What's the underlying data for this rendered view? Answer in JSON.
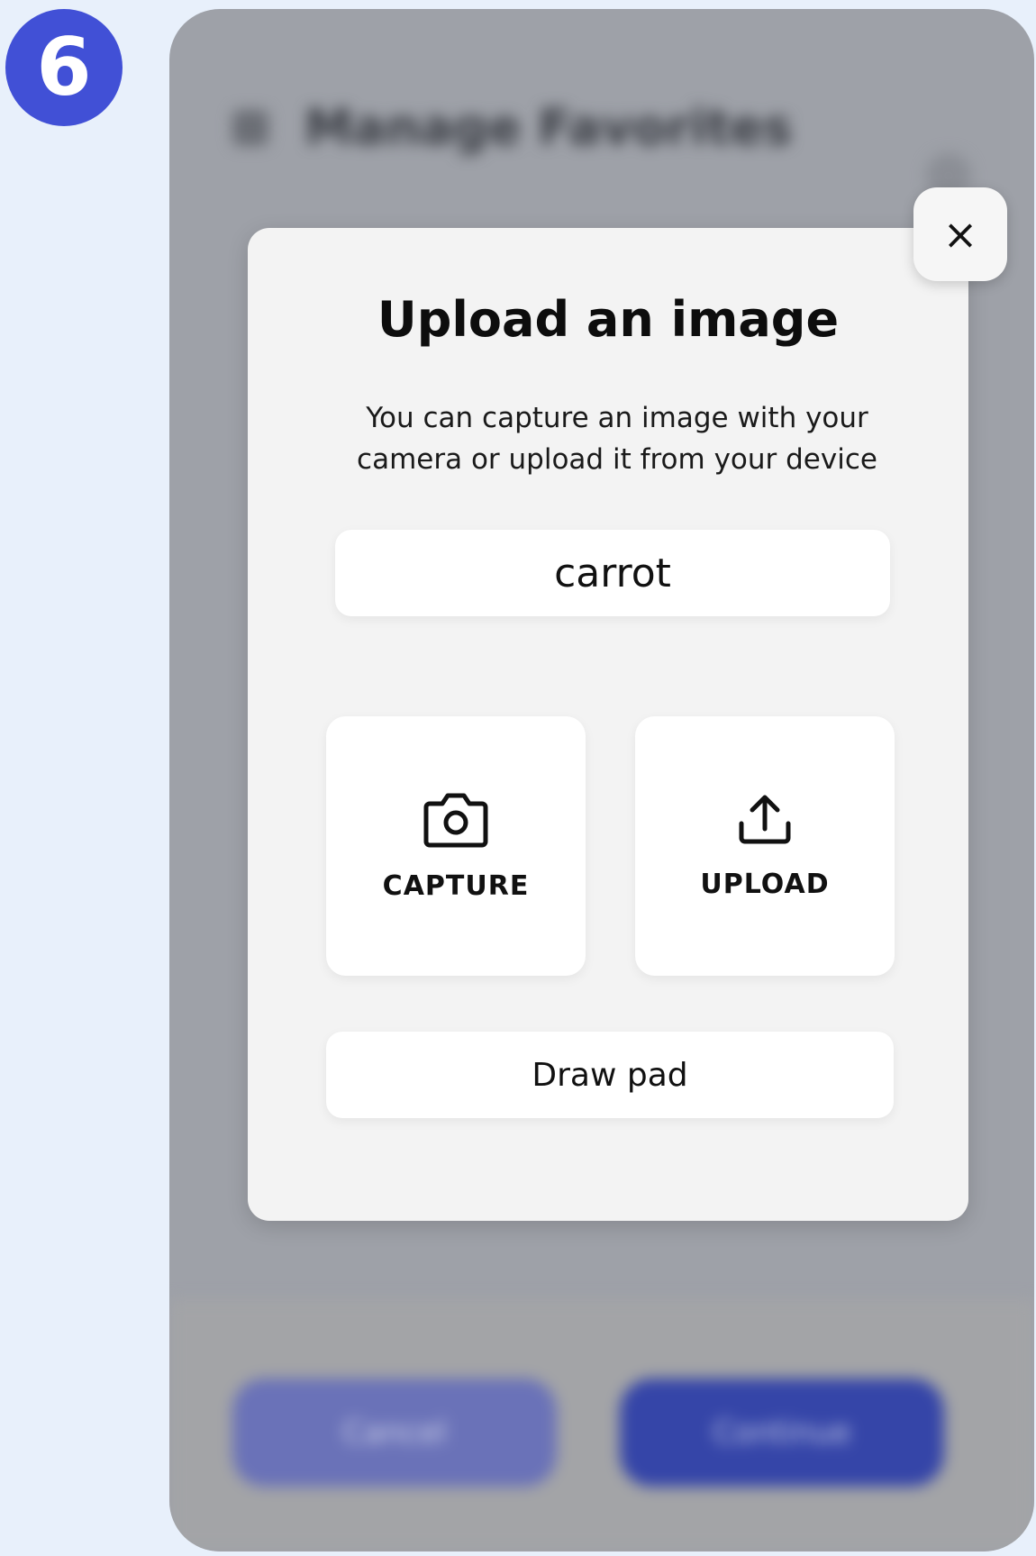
{
  "step": {
    "number": "6"
  },
  "background": {
    "title": "Manage Favorites",
    "left_button": "Cancel",
    "right_button": "Continue"
  },
  "modal": {
    "title": "Upload an image",
    "subtitle": "You can capture an image with your camera or upload it from your device",
    "word": "carrot",
    "capture_label": "CAPTURE",
    "upload_label": "UPLOAD",
    "draw_pad_label": "Draw pad",
    "close_symbol": "×"
  },
  "icons": {
    "close": "close-icon",
    "capture": "camera-icon",
    "upload": "upload-icon",
    "back": "back-arrow-icon"
  },
  "colors": {
    "badge": "#4150d6",
    "page_background": "#e8f0fb",
    "modal_background": "#f3f3f3",
    "overlay": "#9ea1a8"
  }
}
